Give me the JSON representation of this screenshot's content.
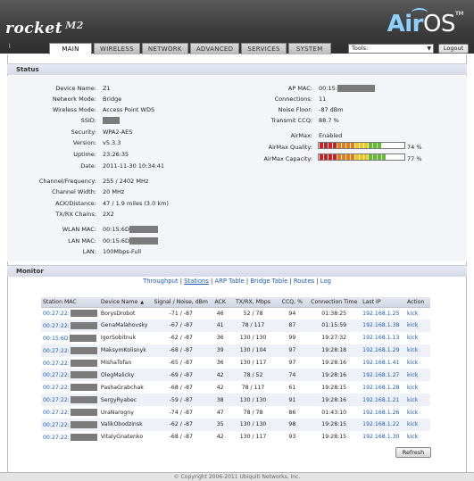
{
  "header": {
    "product_logo": "rocket",
    "product_model": "M2",
    "brand_logo_a": "Air",
    "brand_logo_b": "OS",
    "brand_tm": "TM",
    "tabs": [
      "MAIN",
      "WIRELESS",
      "NETWORK",
      "ADVANCED",
      "SERVICES",
      "SYSTEM"
    ],
    "active_tab": "MAIN",
    "tools_label": "Tools:",
    "logout_label": "Logout"
  },
  "status": {
    "title": "Status",
    "left": [
      {
        "k": "Device Name:",
        "v": "Z1"
      },
      {
        "k": "Network Mode:",
        "v": "Bridge"
      },
      {
        "k": "Wireless Mode:",
        "v": "Access Point WDS"
      },
      {
        "k": "SSID:",
        "v": ""
      },
      {
        "k": "Security:",
        "v": "WPA2-AES"
      },
      {
        "k": "Version:",
        "v": "v5.3.3"
      },
      {
        "k": "Uptime:",
        "v": "23:26:35"
      },
      {
        "k": "Date:",
        "v": "2011-11-30 10:34:41"
      },
      {
        "k": "Channel/Frequency:",
        "v": "255 / 2402 MHz"
      },
      {
        "k": "Channel Width:",
        "v": "20 MHz"
      },
      {
        "k": "ACK/Distance:",
        "v": "47 / 1.9 miles (3.0 km)"
      },
      {
        "k": "TX/RX Chains:",
        "v": "2X2"
      },
      {
        "k": "WLAN MAC:",
        "v": "00:15:6D"
      },
      {
        "k": "LAN MAC:",
        "v": "00:15:6D"
      },
      {
        "k": "LAN:",
        "v": "100Mbps-Full"
      }
    ],
    "right": [
      {
        "k": "AP MAC:",
        "v": "00:15:"
      },
      {
        "k": "Connections:",
        "v": "11"
      },
      {
        "k": "Noise Floor:",
        "v": "-87 dBm"
      },
      {
        "k": "Transmit CCQ:",
        "v": "88.7 %"
      },
      {
        "k": "AirMax:",
        "v": "Enabled"
      },
      {
        "k": "AirMax Quality:",
        "v": "74 %"
      },
      {
        "k": "AirMax Capacity:",
        "v": "77 %"
      }
    ],
    "airmax_quality_fraction": 0.74,
    "airmax_capacity_fraction": 0.77
  },
  "monitor": {
    "title": "Monitor",
    "links": [
      "Throughput",
      "Stations",
      "ARP Table",
      "Bridge Table",
      "Routes",
      "Log"
    ],
    "active_link": "Stations",
    "columns": [
      "Station MAC",
      "Device Name",
      "Signal / Noise, dBm",
      "ACK",
      "TX/RX, Mbps",
      "CCQ, %",
      "Connection Time",
      "Last IP",
      "Action"
    ],
    "rows": [
      {
        "mac": "00:27:22:",
        "name": "BorysDrobot",
        "signal": "-71 / -87",
        "ack": "46",
        "txrx": "52 / 78",
        "ccq": "94",
        "time": "01:38:25",
        "ip": "192.168.1.25",
        "action": "kick"
      },
      {
        "mac": "00:27:22:",
        "name": "GenaMalahovsky",
        "signal": "-67 / -87",
        "ack": "41",
        "txrx": "78 / 117",
        "ccq": "87",
        "time": "01:15:59",
        "ip": "192.168.1.38",
        "action": "kick"
      },
      {
        "mac": "00:15:6D",
        "name": "IgorSobitnuk",
        "signal": "-62 / -87",
        "ack": "36",
        "txrx": "130 / 130",
        "ccq": "99",
        "time": "19:27:32",
        "ip": "192.168.1.13",
        "action": "kick"
      },
      {
        "mac": "00:27:22:",
        "name": "MaksymKolisnyk",
        "signal": "-68 / -87",
        "ack": "39",
        "txrx": "130 / 104",
        "ccq": "97",
        "time": "19:28:18",
        "ip": "192.168.1.29",
        "action": "kick"
      },
      {
        "mac": "00:27:22:",
        "name": "MishaTofan",
        "signal": "-65 / -87",
        "ack": "36",
        "txrx": "130 / 117",
        "ccq": "97",
        "time": "19:28:16",
        "ip": "192.168.1.41",
        "action": "kick"
      },
      {
        "mac": "00:27:22:",
        "name": "OlegMalicky",
        "signal": "-69 / -87",
        "ack": "42",
        "txrx": "78 / 52",
        "ccq": "74",
        "time": "19:28:16",
        "ip": "192.168.1.27",
        "action": "kick"
      },
      {
        "mac": "00:27:22:",
        "name": "PashaGrabchak",
        "signal": "-68 / -87",
        "ack": "42",
        "txrx": "78 / 117",
        "ccq": "61",
        "time": "19:28:15",
        "ip": "192.168.1.28",
        "action": "kick"
      },
      {
        "mac": "00:27:22:",
        "name": "SergyRyabec",
        "signal": "-59 / -87",
        "ack": "38",
        "txrx": "130 / 130",
        "ccq": "91",
        "time": "19:28:16",
        "ip": "192.168.1.21",
        "action": "kick"
      },
      {
        "mac": "00:27:22:",
        "name": "UraNarogny",
        "signal": "-74 / -87",
        "ack": "47",
        "txrx": "78 / 78",
        "ccq": "86",
        "time": "01:43:10",
        "ip": "192.168.1.26",
        "action": "kick"
      },
      {
        "mac": "00:27:22:",
        "name": "ValikObodzinsk",
        "signal": "-62 / -87",
        "ack": "35",
        "txrx": "130 / 130",
        "ccq": "98",
        "time": "19:28:15",
        "ip": "192.168.1.22",
        "action": "kick"
      },
      {
        "mac": "00:27:22:",
        "name": "VitalyGnatenko",
        "signal": "-68 / -87",
        "ack": "42",
        "txrx": "130 / 117",
        "ccq": "93",
        "time": "19:28:15",
        "ip": "192.168.1.30",
        "action": "kick"
      }
    ],
    "refresh_label": "Refresh"
  },
  "footer": {
    "text": "© Copyright 2006-2011 Ubiquiti Networks, Inc."
  }
}
